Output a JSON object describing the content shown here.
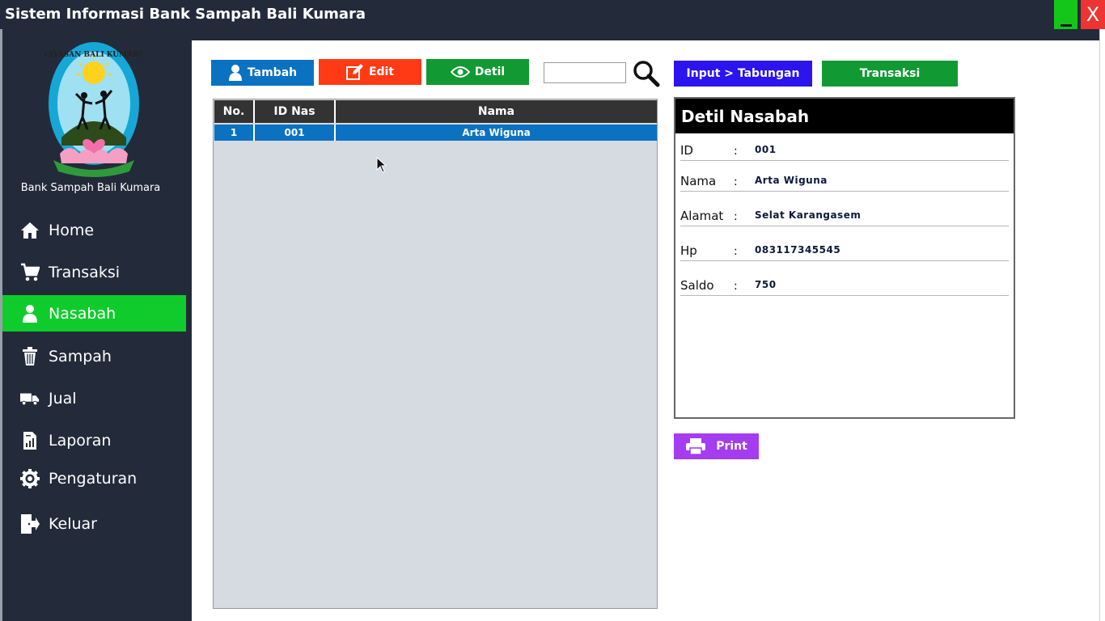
{
  "window": {
    "title": "Sistem Informasi Bank Sampah Bali Kumara",
    "minimize_label": "_",
    "close_label": "X"
  },
  "sidebar": {
    "logo_text": "YAYASAN BALI KUMARA",
    "brand": "Bank Sampah Bali Kumara",
    "items": [
      {
        "label": "Home",
        "icon": "home-icon"
      },
      {
        "label": "Transaksi",
        "icon": "cart-icon"
      },
      {
        "label": "Nasabah",
        "icon": "user-icon",
        "active": true
      },
      {
        "label": "Sampah",
        "icon": "trash-icon"
      },
      {
        "label": "Jual",
        "icon": "truck-icon"
      },
      {
        "label": "Laporan",
        "icon": "report-icon"
      },
      {
        "label": "Pengaturan",
        "icon": "gear-icon"
      },
      {
        "label": "Keluar",
        "icon": "exit-icon"
      }
    ]
  },
  "toolbar": {
    "tambah_label": "Tambah",
    "edit_label": "Edit",
    "detil_label": "Detil",
    "search_value": "",
    "input_tabungan_label": "Input > Tabungan",
    "transaksi_label": "Transaksi"
  },
  "table": {
    "columns": [
      "No.",
      "ID Nas",
      "Nama"
    ],
    "rows": [
      {
        "no": "1",
        "id": "001",
        "nama": "Arta Wiguna",
        "selected": true
      }
    ]
  },
  "detail": {
    "title": "Detil Nasabah",
    "fields": [
      {
        "label": "ID",
        "colon": ":",
        "value": "001"
      },
      {
        "label": "Nama",
        "colon": ":",
        "value": "Arta Wiguna"
      },
      {
        "label": "Alamat",
        "colon": ":",
        "value": "Selat Karangasem"
      },
      {
        "label": "Hp",
        "colon": ":",
        "value": "083117345545"
      },
      {
        "label": "Saldo",
        "colon": ":",
        "value": "750"
      }
    ]
  },
  "print_label": "Print",
  "colors": {
    "sidebar_bg": "#232b3a",
    "active_nav": "#0fcc2c",
    "primary_blue": "#0b72c2",
    "edit_red": "#ff3a14",
    "green": "#119a33",
    "indigo": "#2b14ee",
    "purple": "#a43cf0"
  }
}
